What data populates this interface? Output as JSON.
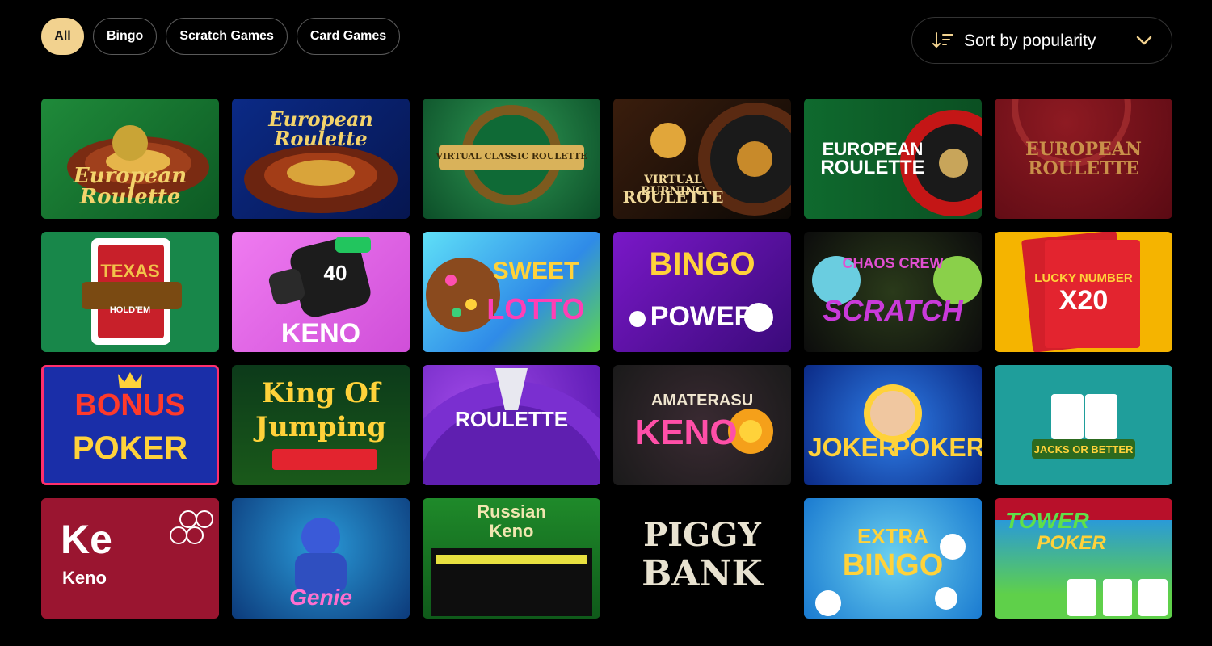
{
  "filters": [
    {
      "label": "All",
      "active": true
    },
    {
      "label": "Bingo",
      "active": false
    },
    {
      "label": "Scratch Games",
      "active": false
    },
    {
      "label": "Card Games",
      "active": false
    }
  ],
  "sort": {
    "label": "Sort by popularity",
    "icon": "sort-icon",
    "chevron": "chevron-down-icon"
  },
  "colors": {
    "accent": "#f2d28f",
    "background": "#000000"
  },
  "games": [
    {
      "title": "European Roulette",
      "title2": ""
    },
    {
      "title": "European Roulette",
      "title2": ""
    },
    {
      "title": "VIRTUAL CLASSIC ROULETTE",
      "title2": ""
    },
    {
      "title": "VIRTUAL BURNING",
      "title2": "ROULETTE"
    },
    {
      "title": "EUROPEAN",
      "title2": "ROULETTE"
    },
    {
      "title": "EUROPEAN",
      "title2": "ROULETTE"
    },
    {
      "title": "TEXAS",
      "title2": "HOLD'EM"
    },
    {
      "title": "KENO",
      "title2": "40"
    },
    {
      "title": "SWEET",
      "title2": "LOTTO"
    },
    {
      "title": "BINGO",
      "title2": "POWER"
    },
    {
      "title": "CHAOS CREW",
      "title2": "SCRATCH"
    },
    {
      "title": "LUCKY NUMBER",
      "title2": "X20"
    },
    {
      "title": "BONUS",
      "title2": "POKER"
    },
    {
      "title": "King Of",
      "title2": "Jumping"
    },
    {
      "title": "ROULETTE",
      "title2": ""
    },
    {
      "title": "AMATERASU",
      "title2": "KENO"
    },
    {
      "title": "JOKER",
      "title2": "POKER"
    },
    {
      "title": "JACKS OR BETTER",
      "title2": ""
    },
    {
      "title": "Ke",
      "title2": "Keno"
    },
    {
      "title": "Genie",
      "title2": ""
    },
    {
      "title": "Russian",
      "title2": "Keno"
    },
    {
      "title": "PIGGY",
      "title2": "BANK"
    },
    {
      "title": "EXTRA",
      "title2": "BINGO"
    },
    {
      "title": "TOWER",
      "title2": "POKER"
    }
  ]
}
